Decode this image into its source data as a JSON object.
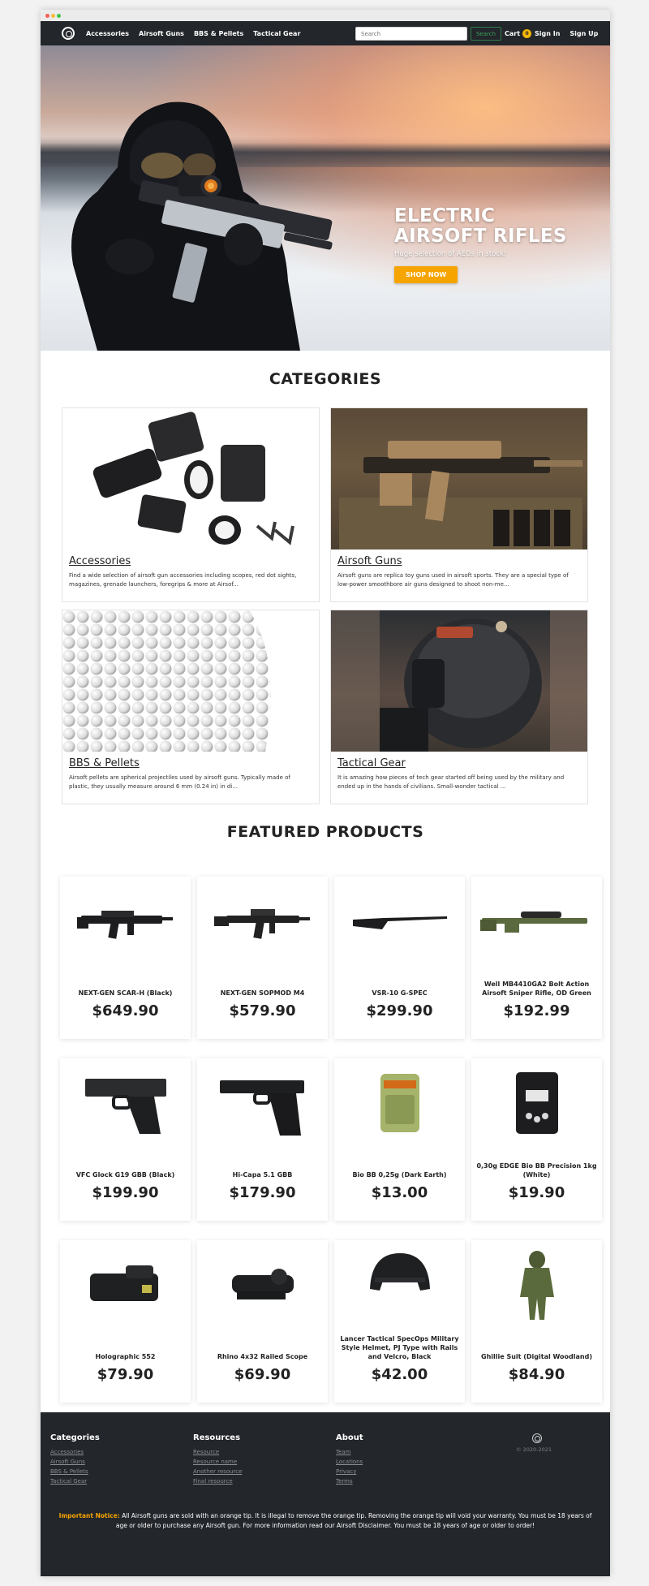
{
  "nav": {
    "links": [
      "Accessories",
      "Airsoft Guns",
      "BBS & Pellets",
      "Tactical Gear"
    ],
    "search_placeholder": "Search",
    "search_button": "Search",
    "cart_label": "Cart",
    "cart_count": "0",
    "sign_in": "Sign In",
    "sign_up": "Sign Up"
  },
  "hero": {
    "title_line1": "ELECTRIC",
    "title_line2": "AIRSOFT RIFLES",
    "subtitle": "Huge selection of AEGs in stock!",
    "button": "SHOP NOW"
  },
  "categories": {
    "heading": "CATEGORIES",
    "items": [
      {
        "title": "Accessories",
        "description": "Find a wide selection of airsoft gun accessories including scopes, red dot sights, magazines, grenade launchers, foregrips & more at Airsof..."
      },
      {
        "title": "Airsoft Guns",
        "description": "Airsoft guns are replica toy guns used in airsoft sports. They are a special type of low-power smoothbore air guns designed to shoot non-me..."
      },
      {
        "title": "BBS & Pellets",
        "description": "Airsoft pellets are spherical projectiles used by airsoft guns. Typically made of plastic, they usually measure around 6 mm (0.24 in) in di..."
      },
      {
        "title": "Tactical Gear",
        "description": "It is amazing how pieces of tech gear started off being used by the military and ended up in the hands of civilians. Small-wonder tactical ..."
      }
    ]
  },
  "featured": {
    "heading": "FEATURED PRODUCTS",
    "products": [
      {
        "name": "NEXT-GEN SCAR-H (Black)",
        "price": "$649.90"
      },
      {
        "name": "NEXT-GEN SOPMOD M4",
        "price": "$579.90"
      },
      {
        "name": "VSR-10 G-SPEC",
        "price": "$299.90"
      },
      {
        "name": "Well MB4410GA2 Bolt Action Airsoft Sniper Rifle, OD Green",
        "price": "$192.99"
      },
      {
        "name": "VFC Glock G19 GBB (Black)",
        "price": "$199.90"
      },
      {
        "name": "Hi-Capa 5.1 GBB",
        "price": "$179.90"
      },
      {
        "name": "Bio BB 0,25g (Dark Earth)",
        "price": "$13.00"
      },
      {
        "name": "0,30g EDGE Bio BB Precision 1kg (White)",
        "price": "$19.90"
      },
      {
        "name": "Holographic 552",
        "price": "$79.90"
      },
      {
        "name": "Rhino 4x32 Railed Scope",
        "price": "$69.90"
      },
      {
        "name": "Lancer Tactical SpecOps Military Style Helmet, PJ Type with Rails and Velcro, Black",
        "price": "$42.00"
      },
      {
        "name": "Ghillie Suit (Digital Woodland)",
        "price": "$84.90"
      }
    ]
  },
  "footer": {
    "columns": [
      {
        "heading": "Categories",
        "links": [
          "Accessories",
          "Airsoft Guns",
          "BBS & Pellets",
          "Tactical Gear"
        ]
      },
      {
        "heading": "Resources",
        "links": [
          "Resource",
          "Resource name",
          "Another resource",
          "Final resource"
        ]
      },
      {
        "heading": "About",
        "links": [
          "Team",
          "Locations",
          "Privacy",
          "Terms"
        ]
      }
    ],
    "copyright": "© 2020-2021",
    "notice_label": "Important Notice:",
    "notice_text": " All Airsoft guns are sold with an orange tip. It is illegal to remove the orange tip. Removing the orange tip will void your warranty. You must be 18 years of age or older to purchase any Airsoft gun. For more information read our Airsoft Disclaimer. You must be 18 years of age or older to order!"
  },
  "colors": {
    "nav_bg": "#23262b",
    "accent_orange": "#f6a400",
    "search_green": "#3aa35c",
    "badge_yellow": "#f2b705"
  }
}
